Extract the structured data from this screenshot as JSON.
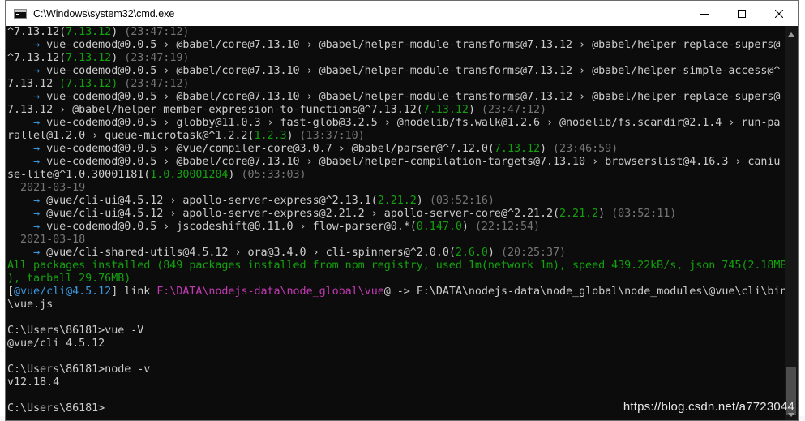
{
  "window": {
    "title": "C:\\Windows\\system32\\cmd.exe",
    "icons": {
      "app": "cmd-icon",
      "minimize": "minimize-icon",
      "maximize": "maximize-icon",
      "close": "close-icon"
    }
  },
  "colors": {
    "background": "#0c0c0c",
    "text": "#cccccc",
    "green": "#13a10e",
    "cyan": "#3a96dd",
    "magenta": "#c239b3",
    "gray": "#767676"
  },
  "console": {
    "lines": [
      [
        {
          "t": "^7.13.12(",
          "c": "white"
        },
        {
          "t": "7.13.12",
          "c": "green"
        },
        {
          "t": ") ",
          "c": "white"
        },
        {
          "t": "(23:47:12)",
          "c": "gray"
        }
      ],
      [
        {
          "t": "    ",
          "c": "white"
        },
        {
          "t": "→",
          "c": "cyan"
        },
        {
          "t": " vue-codemod@0.0.5 › @babel/core@7.13.10 › @babel/helper-module-transforms@7.13.12 › @babel/helper-replace-supers@",
          "c": "white"
        }
      ],
      [
        {
          "t": "^7.13.12(",
          "c": "white"
        },
        {
          "t": "7.13.12",
          "c": "green"
        },
        {
          "t": ") ",
          "c": "white"
        },
        {
          "t": "(23:47:19)",
          "c": "gray"
        }
      ],
      [
        {
          "t": "    ",
          "c": "white"
        },
        {
          "t": "→",
          "c": "cyan"
        },
        {
          "t": " vue-codemod@0.0.5 › @babel/core@7.13.10 › @babel/helper-module-transforms@7.13.12 › @babel/helper-simple-access@^",
          "c": "white"
        }
      ],
      [
        {
          "t": "7.13.12 ",
          "c": "white"
        },
        {
          "t": "(7.13.12)",
          "c": "green"
        },
        {
          "t": " ",
          "c": "white"
        },
        {
          "t": "(23:47:12)",
          "c": "gray"
        }
      ],
      [
        {
          "t": "    ",
          "c": "white"
        },
        {
          "t": "→",
          "c": "cyan"
        },
        {
          "t": " vue-codemod@0.0.5 › @babel/core@7.13.10 › @babel/helper-module-transforms@7.13.12 › @babel/helper-replace-supers@",
          "c": "white"
        }
      ],
      [
        {
          "t": "7.13.12 › @babel/helper-member-expression-to-functions@^7.13.12(",
          "c": "white"
        },
        {
          "t": "7.13.12",
          "c": "green"
        },
        {
          "t": ") ",
          "c": "white"
        },
        {
          "t": "(23:47:12)",
          "c": "gray"
        }
      ],
      [
        {
          "t": "    ",
          "c": "white"
        },
        {
          "t": "→",
          "c": "cyan"
        },
        {
          "t": " vue-codemod@0.0.5 › globby@11.0.3 › fast-glob@3.2.5 › @nodelib/fs.walk@1.2.6 › @nodelib/fs.scandir@2.1.4 › run-pa",
          "c": "white"
        }
      ],
      [
        {
          "t": "rallel@1.2.0 › queue-microtask@^1.2.2(",
          "c": "white"
        },
        {
          "t": "1.2.3",
          "c": "green"
        },
        {
          "t": ") ",
          "c": "white"
        },
        {
          "t": "(13:37:10)",
          "c": "gray"
        }
      ],
      [
        {
          "t": "    ",
          "c": "white"
        },
        {
          "t": "→",
          "c": "cyan"
        },
        {
          "t": " vue-codemod@0.0.5 › @vue/compiler-core@3.0.7 › @babel/parser@^7.12.0(",
          "c": "white"
        },
        {
          "t": "7.13.12",
          "c": "green"
        },
        {
          "t": ") ",
          "c": "white"
        },
        {
          "t": "(23:46:59)",
          "c": "gray"
        }
      ],
      [
        {
          "t": "    ",
          "c": "white"
        },
        {
          "t": "→",
          "c": "cyan"
        },
        {
          "t": " vue-codemod@0.0.5 › @babel/core@7.13.10 › @babel/helper-compilation-targets@7.13.10 › browserslist@4.16.3 › caniu",
          "c": "white"
        }
      ],
      [
        {
          "t": "se-lite@^1.0.30001181(",
          "c": "white"
        },
        {
          "t": "1.0.30001204",
          "c": "green"
        },
        {
          "t": ") ",
          "c": "white"
        },
        {
          "t": "(05:33:03)",
          "c": "gray"
        }
      ],
      [
        {
          "t": "  2021-03-19",
          "c": "gray"
        }
      ],
      [
        {
          "t": "    ",
          "c": "white"
        },
        {
          "t": "→",
          "c": "cyan"
        },
        {
          "t": " @vue/cli-ui@4.5.12 › apollo-server-express@^2.13.1(",
          "c": "white"
        },
        {
          "t": "2.21.2",
          "c": "green"
        },
        {
          "t": ") ",
          "c": "white"
        },
        {
          "t": "(03:52:16)",
          "c": "gray"
        }
      ],
      [
        {
          "t": "    ",
          "c": "white"
        },
        {
          "t": "→",
          "c": "cyan"
        },
        {
          "t": " @vue/cli-ui@4.5.12 › apollo-server-express@2.21.2 › apollo-server-core@^2.21.2(",
          "c": "white"
        },
        {
          "t": "2.21.2",
          "c": "green"
        },
        {
          "t": ") ",
          "c": "white"
        },
        {
          "t": "(03:52:11)",
          "c": "gray"
        }
      ],
      [
        {
          "t": "    ",
          "c": "white"
        },
        {
          "t": "→",
          "c": "cyan"
        },
        {
          "t": " vue-codemod@0.0.5 › jscodeshift@0.11.0 › flow-parser@0.*(",
          "c": "white"
        },
        {
          "t": "0.147.0",
          "c": "green"
        },
        {
          "t": ") ",
          "c": "white"
        },
        {
          "t": "(22:12:54)",
          "c": "gray"
        }
      ],
      [
        {
          "t": "  2021-03-18",
          "c": "gray"
        }
      ],
      [
        {
          "t": "    ",
          "c": "white"
        },
        {
          "t": "→",
          "c": "cyan"
        },
        {
          "t": " @vue/cli-shared-utils@4.5.12 › ora@3.4.0 › cli-spinners@^2.0.0(",
          "c": "white"
        },
        {
          "t": "2.6.0",
          "c": "green"
        },
        {
          "t": ") ",
          "c": "white"
        },
        {
          "t": "(20:25:37)",
          "c": "gray"
        }
      ],
      [
        {
          "t": "All packages installed (849 packages installed from npm registry, used 1m(network 1m), speed 439.22kB/s, json 745(2.18MB",
          "c": "green"
        }
      ],
      [
        {
          "t": "), tarball 29.76MB)",
          "c": "green"
        }
      ],
      [
        {
          "t": "[",
          "c": "white"
        },
        {
          "t": "@vue/cli@4.5.12",
          "c": "cyan"
        },
        {
          "t": "] link ",
          "c": "white"
        },
        {
          "t": "F:\\DATA\\nodejs-data\\node_global\\vue",
          "c": "magenta"
        },
        {
          "t": "@ -> F:\\DATA\\nodejs-data\\node_global\\node_modules\\@vue\\cli\\bin",
          "c": "white"
        }
      ],
      [
        {
          "t": "\\vue.js",
          "c": "white"
        }
      ],
      [
        {
          "t": "",
          "c": "white"
        }
      ],
      [
        {
          "t": "C:\\Users\\86181>vue -V",
          "c": "white"
        }
      ],
      [
        {
          "t": "@vue/cli 4.5.12",
          "c": "white"
        }
      ],
      [
        {
          "t": "",
          "c": "white"
        }
      ],
      [
        {
          "t": "C:\\Users\\86181>node -v",
          "c": "white"
        }
      ],
      [
        {
          "t": "v12.18.4",
          "c": "white"
        }
      ],
      [
        {
          "t": "",
          "c": "white"
        }
      ],
      [
        {
          "t": "C:\\Users\\86181>",
          "c": "white"
        }
      ]
    ]
  },
  "scrollbar": {
    "icons": {
      "up": "scroll-up-arrow-icon",
      "down": "scroll-down-arrow-icon"
    }
  },
  "watermark": "https://blog.csdn.net/a7723044"
}
